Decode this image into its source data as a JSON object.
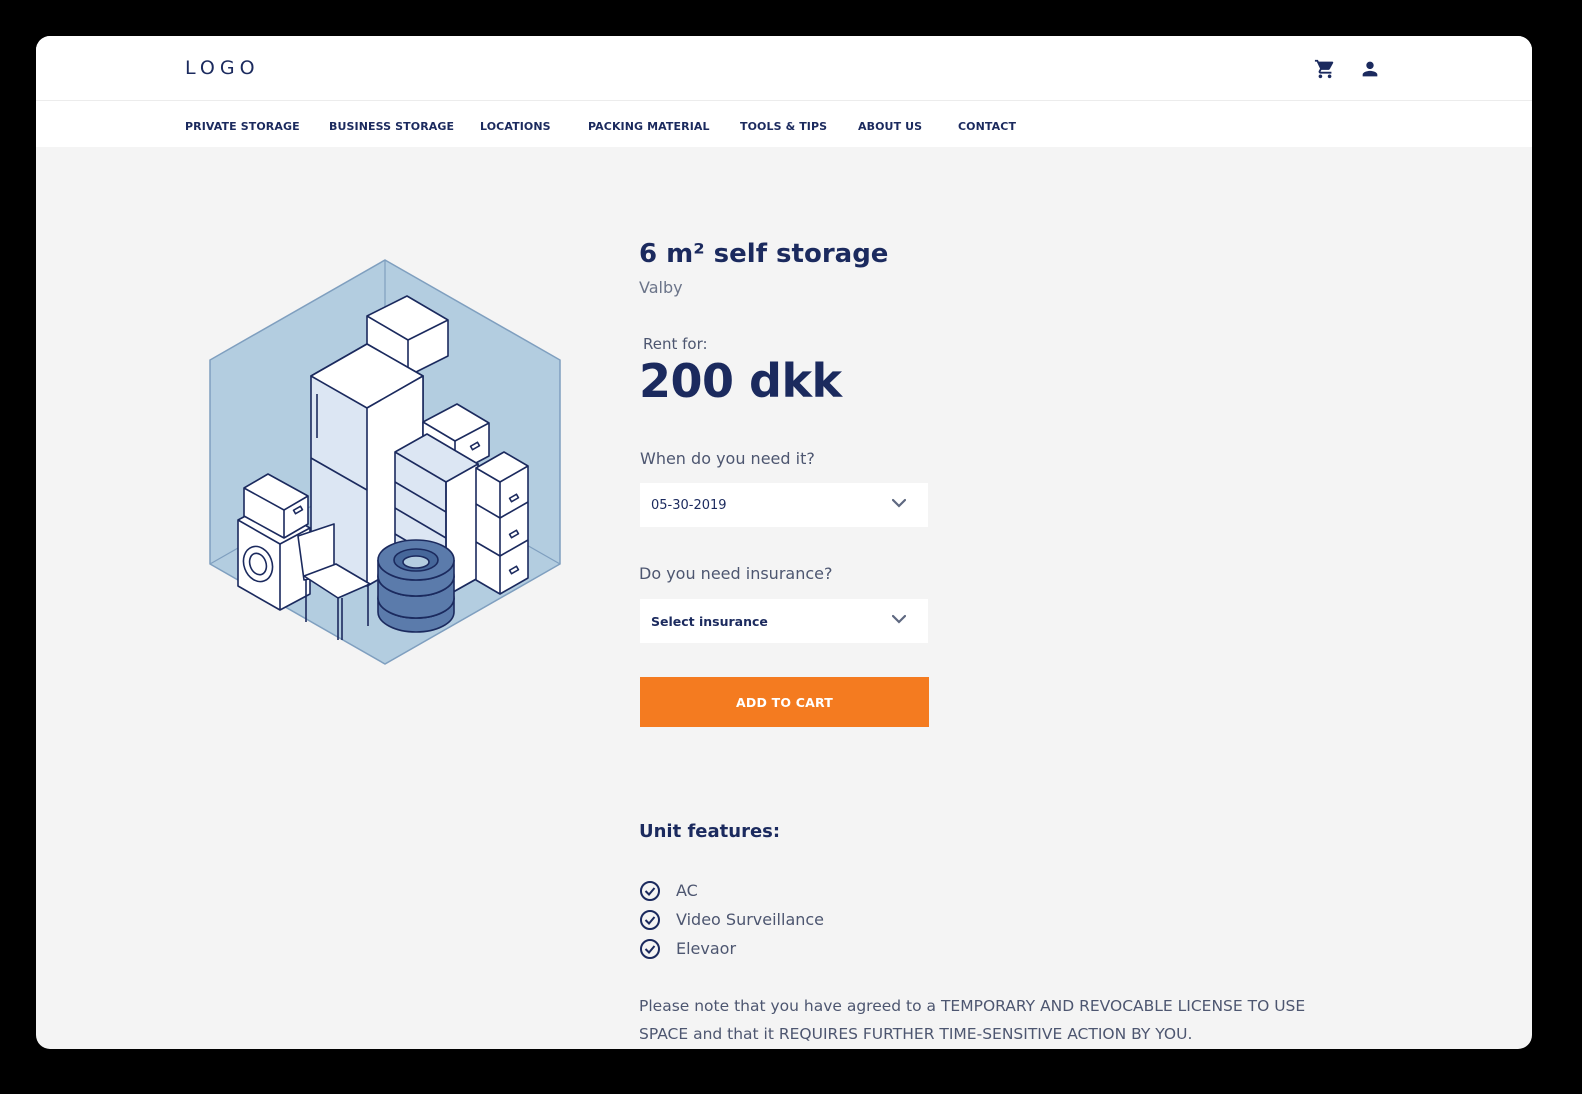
{
  "header": {
    "logo": "LOGO",
    "icons": [
      "cart-icon",
      "user-icon"
    ]
  },
  "nav": {
    "items": [
      {
        "label": "PRIVATE STORAGE"
      },
      {
        "label": "BUSINESS STORAGE"
      },
      {
        "label": "LOCATIONS"
      },
      {
        "label": "PACKING MATERIAL"
      },
      {
        "label": "TOOLS & TIPS"
      },
      {
        "label": "ABOUT US"
      },
      {
        "label": "CONTACT"
      }
    ]
  },
  "product": {
    "title": "6 m² self storage",
    "location": "Valby",
    "rent_label": "Rent for:",
    "price": "200 dkk"
  },
  "form": {
    "date_question": "When do you need it?",
    "date_value": "05-30-2019",
    "insurance_question": "Do you need insurance?",
    "insurance_value": "Select insurance",
    "add_to_cart": "ADD TO CART"
  },
  "features": {
    "title": "Unit features:",
    "items": [
      "AC",
      "Video Surveillance",
      "Elevaor"
    ]
  },
  "note": "Please note that you have agreed to a TEMPORARY AND REVOCABLE LICENSE TO USE SPACE and that it REQUIRES FURTHER TIME-SENSITIVE ACTION BY YOU.",
  "colors": {
    "brand_navy": "#1b2a5e",
    "accent_orange": "#f47b20",
    "illustration_blue": "#b3cde0",
    "background": "#f4f4f4"
  }
}
